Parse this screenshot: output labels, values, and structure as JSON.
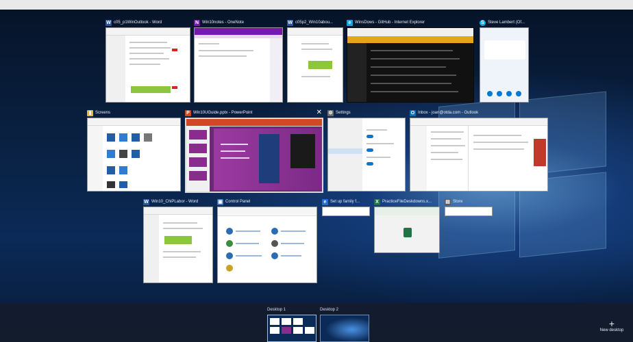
{
  "windows": [
    {
      "title": "c05_p1WinOutlook - Word",
      "app": "word"
    },
    {
      "title": "Win10notes - OneNote",
      "app": "onenote"
    },
    {
      "title": "c05p2_Win10abou...",
      "app": "word"
    },
    {
      "title": "WinsDows - GitHub - Internet Explorer",
      "app": "ie"
    },
    {
      "title": "Steve Lambert (Of...",
      "app": "skype"
    },
    {
      "title": "Screens",
      "app": "explorer"
    },
    {
      "title": "Win10UGuide.pptx - PowerPoint",
      "app": "powerpoint"
    },
    {
      "title": "Settings",
      "app": "settings"
    },
    {
      "title": "Inbox - joan@otda.com - Outlook",
      "app": "outlook"
    },
    {
      "title": "Win10_ChiPLabor - Word",
      "app": "word"
    },
    {
      "title": "Control Panel",
      "app": "controlpanel"
    },
    {
      "title": "Set up family f...",
      "app": "edge"
    },
    {
      "title": "PracticeFileDeskdowns.x...",
      "app": "excel"
    },
    {
      "title": "Store",
      "app": "store"
    }
  ],
  "close_glyph": "✕",
  "desktops": [
    "Desktop 1",
    "Desktop 2"
  ],
  "new_desktop": {
    "icon": "+",
    "label": "New desktop"
  },
  "icons": {
    "word": "W",
    "onenote": "N",
    "ie": "e",
    "skype": "S",
    "explorer": "▮",
    "powerpoint": "P",
    "settings": "⚙",
    "outlook": "O",
    "controlpanel": "▣",
    "edge": "e",
    "excel": "X",
    "store": "▤"
  },
  "colors": {
    "word": "#2b579a",
    "onenote": "#7719aa",
    "powerpoint": "#d24726",
    "excel": "#217346",
    "outlook": "#0072c6",
    "ie": "#1ba1e2",
    "skype": "#00aff0",
    "explorer": "#e8b83f",
    "settings": "#6b6b6b",
    "controlpanel": "#3c6fb4",
    "edge": "#1e6fd1",
    "store": "#5a5a5a",
    "slide_bg": "#8a2c8e",
    "accent": "#3b8eea"
  }
}
